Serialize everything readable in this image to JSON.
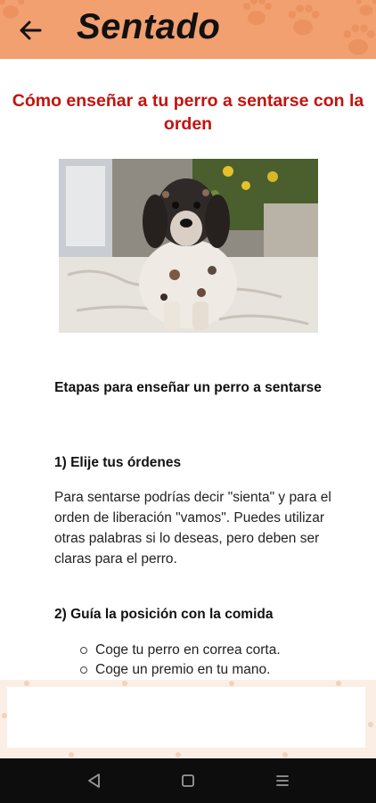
{
  "header": {
    "title": "Sentado",
    "back_icon": "arrow-left-icon"
  },
  "article": {
    "title": "Cómo enseñar a tu perro a sentarse con la orden",
    "image_subject": "dog-photo",
    "section_heading": "Etapas para enseñar un perro a sentarse",
    "steps": [
      {
        "title": "1) Elije tus órdenes",
        "text": "Para sentarse podrías decir \"sienta\" y para el orden de liberación \"vamos\". Puedes utilizar otras palabras si lo deseas, pero deben ser claras para el perro."
      },
      {
        "title": "2) Guía la posición con la comida",
        "bullets": [
          "Coge tu perro en correa corta.",
          "Coge un premio en tu mano."
        ]
      }
    ]
  },
  "nav": {
    "back": "triangle-back-icon",
    "home": "square-home-icon",
    "menu": "menu-icon"
  },
  "colors": {
    "header_bg": "#f2a070",
    "title_red": "#c3130f",
    "banner_bg": "#fbeee4",
    "nav_bg": "#0d0d0d"
  }
}
